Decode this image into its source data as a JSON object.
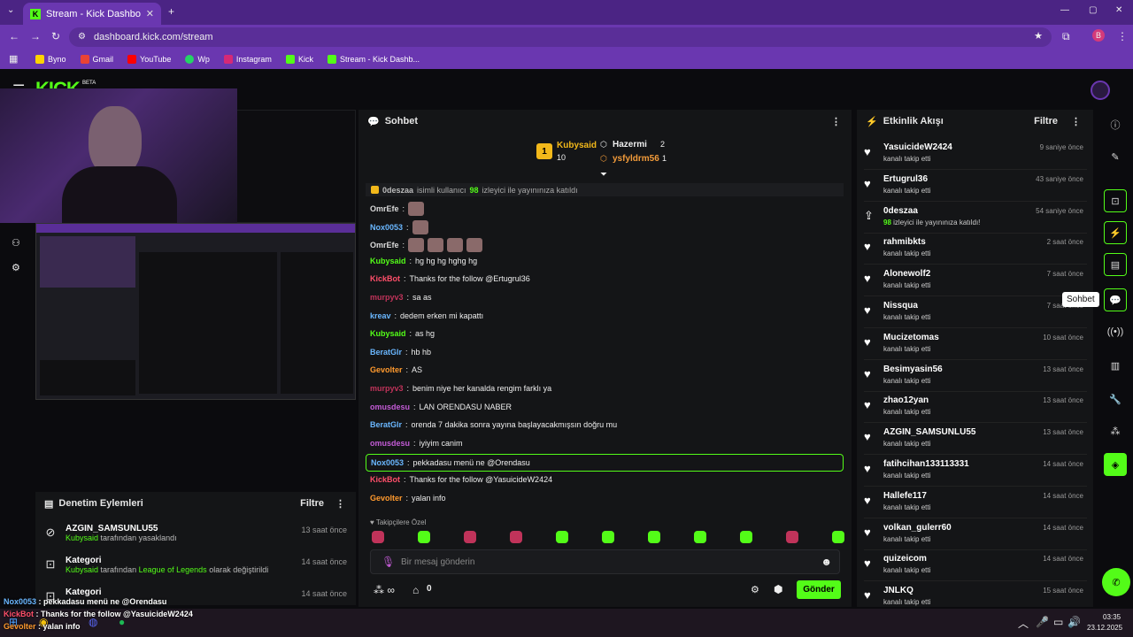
{
  "browser": {
    "tab_title": "Stream - Kick Dashboard",
    "url": "dashboard.kick.com/stream",
    "profile": "B",
    "bookmarks": [
      "Byno",
      "Gmail",
      "YouTube",
      "Wp",
      "Instagram",
      "Kick",
      "Stream - Kick Dashb..."
    ]
  },
  "site": {
    "logo": "KICK",
    "beta": "BETA"
  },
  "moderation": {
    "title": "Denetim Eylemleri",
    "filter": "Filtre",
    "rows": [
      {
        "name": "AZGIN_SAMSUNLU55",
        "actor": "Kubysaid",
        "action": "tarafından yasaklandı",
        "time": "13 saat önce"
      },
      {
        "name": "Kategori",
        "actor": "Kubysaid",
        "action": "tarafından",
        "target": "League of Legends",
        "suffix": "olarak değiştirildi",
        "time": "14 saat önce"
      },
      {
        "name": "Kategori",
        "time": "14 saat önce"
      }
    ]
  },
  "chat": {
    "title": "Sohbet",
    "leaders": [
      {
        "name": "Kubysaid",
        "count": "10",
        "rank": "1"
      },
      {
        "name": "Hazermi",
        "count": "2"
      },
      {
        "name": "ysfyldrm56",
        "count": "1"
      }
    ],
    "join_notice": {
      "user": "0deszaa",
      "pre": "isimli kullanıcı",
      "viewers": "98",
      "post": "izleyici ile yayınınıza katıldı"
    },
    "messages": [
      {
        "user": "OmrEfe",
        "text": "",
        "emotes": 1,
        "color": "#d9d9d9"
      },
      {
        "user": "Nox0053",
        "text": "",
        "emotes": 1,
        "color": "#6ab7ff"
      },
      {
        "user": "OmrEfe",
        "text": "",
        "emotes": 4,
        "color": "#d9d9d9"
      },
      {
        "user": "Kubysaid",
        "text": "hg hg hg hghg hg",
        "color": "#53fc18"
      },
      {
        "user": "KickBot",
        "text": "Thanks for the follow @Ertugrul36",
        "color": "#ff4f6a"
      },
      {
        "user": "murpyv3",
        "text": "sa as",
        "color": "#c0335a"
      },
      {
        "user": "kreav",
        "text": "dedem erken mi kapattı",
        "color": "#6ab7ff"
      },
      {
        "user": "Kubysaid",
        "text": "as hg",
        "color": "#53fc18"
      },
      {
        "user": "BeratGlr",
        "text": "hb hb",
        "color": "#6ab7ff"
      },
      {
        "user": "Gevolter",
        "text": "AS",
        "color": "#ff9a2e"
      },
      {
        "user": "murpyv3",
        "text": "benim niye her kanalda rengim farklı ya",
        "color": "#c0335a"
      },
      {
        "user": "omusdesu",
        "text": "LAN ORENDASU NABER",
        "color": "#c35bd6"
      },
      {
        "user": "BeratGlr",
        "text": "orenda 7 dakika sonra yayına başlayacakmışsın doğru mu",
        "color": "#6ab7ff"
      },
      {
        "user": "omusdesu",
        "text": "iyiyim canim",
        "color": "#c35bd6"
      },
      {
        "user": "Nox0053",
        "text": "pekkadasu menü ne @Orendasu",
        "color": "#6ab7ff"
      },
      {
        "user": "KickBot",
        "text": "Thanks for the follow @YasuicideW2424",
        "color": "#ff4f6a"
      },
      {
        "user": "Gevolter",
        "text": "yalan info",
        "color": "#ff9a2e"
      }
    ],
    "followers_only": "Takipçilere Özel",
    "input_placeholder": "Bir mesaj gönderin",
    "points": "0",
    "send": "Gönder"
  },
  "activity": {
    "title": "Etkinlik Akışı",
    "filter": "Filtre",
    "items": [
      {
        "name": "YasuicideW2424",
        "sub": "kanalı takip etti",
        "time": "9 saniye önce"
      },
      {
        "name": "Ertugrul36",
        "sub": "kanalı takip etti",
        "time": "43 saniye önce"
      },
      {
        "name": "0deszaa",
        "sub_num": "98",
        "sub": "izleyici ile yayınınıza katıldı!",
        "time": "54 saniye önce"
      },
      {
        "name": "rahmibkts",
        "sub": "kanalı takip etti",
        "time": "2 saat önce"
      },
      {
        "name": "Alonewolf2",
        "sub": "kanalı takip etti",
        "time": "7 saat önce"
      },
      {
        "name": "Nissqua",
        "sub": "kanalı takip etti",
        "time": "7 saat önce"
      },
      {
        "name": "Mucizetomas",
        "sub": "kanalı takip etti",
        "time": "10 saat önce"
      },
      {
        "name": "Besimyasin56",
        "sub": "kanalı takip etti",
        "time": "13 saat önce"
      },
      {
        "name": "zhao12yan",
        "sub": "kanalı takip etti",
        "time": "13 saat önce"
      },
      {
        "name": "AZGIN_SAMSUNLU55",
        "sub": "kanalı takip etti",
        "time": "13 saat önce"
      },
      {
        "name": "fatihcihan133113331",
        "sub": "kanalı takip etti",
        "time": "14 saat önce"
      },
      {
        "name": "Hallefe117",
        "sub": "kanalı takip etti",
        "time": "14 saat önce"
      },
      {
        "name": "volkan_gulerr60",
        "sub": "kanalı takip etti",
        "time": "14 saat önce"
      },
      {
        "name": "quizeicom",
        "sub": "kanalı takip etti",
        "time": "14 saat önce"
      },
      {
        "name": "JNLKQ",
        "sub": "kanalı takip etti",
        "time": "15 saat önce"
      }
    ]
  },
  "rail": {
    "tooltip": "Sohbet"
  },
  "overlay": [
    {
      "user": "Nox0053",
      "text": "pekkadasu menü ne @Orendasu"
    },
    {
      "user": "KickBot",
      "text": "Thanks for the follow @YasuicideW2424"
    },
    {
      "user": "Gevolter",
      "text": "yalan info"
    }
  ],
  "taskbar": {
    "time": "03:35",
    "date": "23.12.2025"
  },
  "colors": {
    "accent": "#53fc18",
    "browser": "#6a37b0"
  }
}
